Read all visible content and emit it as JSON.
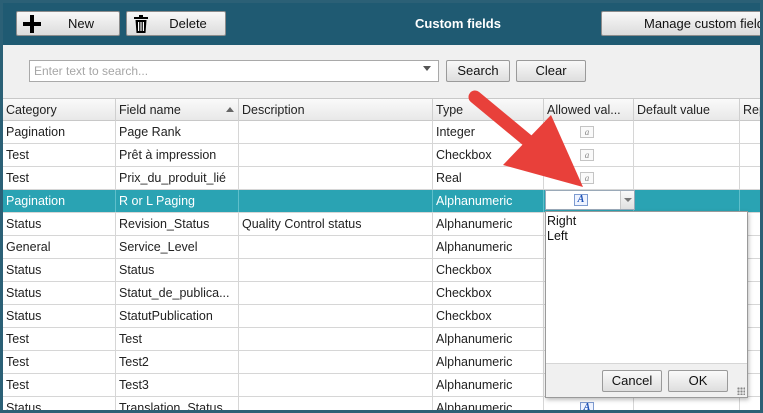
{
  "toolbar": {
    "new_label": "New",
    "delete_label": "Delete",
    "title": "Custom fields",
    "manage_label": "Manage custom fields"
  },
  "search": {
    "placeholder": "Enter text to search...",
    "search_label": "Search",
    "clear_label": "Clear"
  },
  "table": {
    "columns": [
      "Category",
      "Field name",
      "Description",
      "Type",
      "Allowed val...",
      "Default value",
      "Rep"
    ],
    "rows": [
      {
        "category": "Pagination",
        "field": "Page Rank",
        "description": "",
        "type": "Integer",
        "allowed_icon": "text-value-icon"
      },
      {
        "category": "Test",
        "field": "Prêt à impression",
        "description": "",
        "type": "Checkbox",
        "allowed_icon": "text-value-icon"
      },
      {
        "category": "Test",
        "field": "Prix_du_produit_lié",
        "description": "",
        "type": "Real",
        "allowed_icon": "text-value-icon"
      },
      {
        "category": "Pagination",
        "field": "R or L Paging",
        "description": "",
        "type": "Alphanumeric",
        "allowed_icon": "text-value-icon"
      },
      {
        "category": "Status",
        "field": "Revision_Status",
        "description": "Quality Control status",
        "type": "Alphanumeric"
      },
      {
        "category": "General",
        "field": "Service_Level",
        "description": "",
        "type": "Alphanumeric"
      },
      {
        "category": "Status",
        "field": "Status",
        "description": "",
        "type": "Checkbox"
      },
      {
        "category": "Status",
        "field": "Statut_de_publica...",
        "description": "",
        "type": "Checkbox"
      },
      {
        "category": "Status",
        "field": "StatutPublication",
        "description": "",
        "type": "Checkbox"
      },
      {
        "category": "Test",
        "field": "Test",
        "description": "",
        "type": "Alphanumeric"
      },
      {
        "category": "Test",
        "field": "Test2",
        "description": "",
        "type": "Alphanumeric"
      },
      {
        "category": "Test",
        "field": "Test3",
        "description": "",
        "type": "Alphanumeric"
      },
      {
        "category": "Status",
        "field": "Translation_Status",
        "description": "",
        "type": "Alphanumeric",
        "allowed_icon": "text-value-icon"
      }
    ],
    "selected_row": 3
  },
  "popup": {
    "lines": [
      "Right",
      "Left"
    ],
    "cancel_label": "Cancel",
    "ok_label": "OK"
  },
  "colors": {
    "toolbar": "#1f5a72",
    "selected_row": "#2aa3b3",
    "annotation_arrow": "#e8403a"
  }
}
